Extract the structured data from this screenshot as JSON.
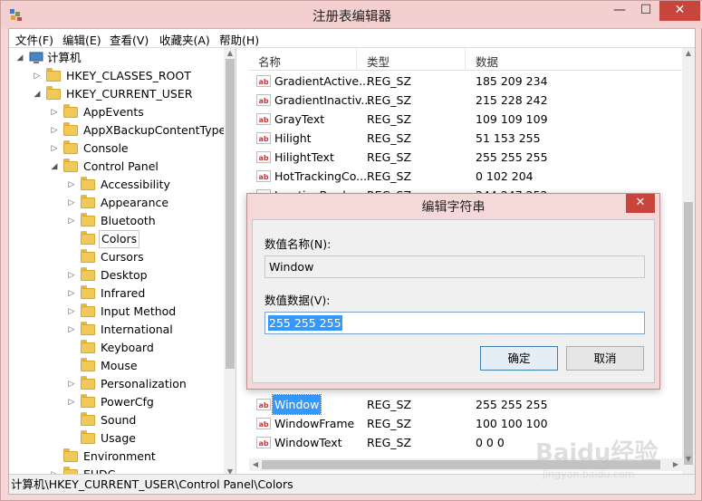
{
  "window": {
    "title": "注册表编辑器",
    "min": "—",
    "max": "☐",
    "close": "✕"
  },
  "menu": [
    "文件(F)",
    "编辑(E)",
    "查看(V)",
    "收藏夹(A)",
    "帮助(H)"
  ],
  "tree": {
    "root": "计算机",
    "hkcr": "HKEY_CLASSES_ROOT",
    "hkcu": "HKEY_CURRENT_USER",
    "hkcu_children": [
      "AppEvents",
      "AppXBackupContentType",
      "Console",
      "Control Panel"
    ],
    "control_panel_children": [
      "Accessibility",
      "Appearance",
      "Bluetooth",
      "Colors",
      "Cursors",
      "Desktop",
      "Infrared",
      "Input Method",
      "International",
      "Keyboard",
      "Mouse",
      "Personalization",
      "PowerCfg",
      "Sound",
      "Usage"
    ],
    "after": [
      "Environment",
      "EUDC"
    ],
    "selected": "Colors"
  },
  "list": {
    "columns": [
      "名称",
      "类型",
      "数据"
    ],
    "rows_top": [
      {
        "name": "GradientActive...",
        "type": "REG_SZ",
        "data": "185 209 234"
      },
      {
        "name": "GradientInactiv...",
        "type": "REG_SZ",
        "data": "215 228 242"
      },
      {
        "name": "GrayText",
        "type": "REG_SZ",
        "data": "109 109 109"
      },
      {
        "name": "Hilight",
        "type": "REG_SZ",
        "data": "51 153 255"
      },
      {
        "name": "HilightText",
        "type": "REG_SZ",
        "data": "255 255 255"
      },
      {
        "name": "HotTrackingCo...",
        "type": "REG_SZ",
        "data": "0 102 204"
      },
      {
        "name": "InactiveBorder",
        "type": "REG_SZ",
        "data": "244 247 252"
      }
    ],
    "rows_bottom": [
      {
        "name": "Window",
        "type": "REG_SZ",
        "data": "255 255 255",
        "selected": true
      },
      {
        "name": "WindowFrame",
        "type": "REG_SZ",
        "data": "100 100 100"
      },
      {
        "name": "WindowText",
        "type": "REG_SZ",
        "data": "0 0 0"
      }
    ],
    "icon_text": "ab"
  },
  "status": "计算机\\HKEY_CURRENT_USER\\Control Panel\\Colors",
  "dialog": {
    "title": "编辑字符串",
    "close": "✕",
    "name_label": "数值名称(N):",
    "name_value": "Window",
    "data_label": "数值数据(V):",
    "data_value": "255 255 255",
    "ok": "确定",
    "cancel": "取消"
  },
  "watermark": {
    "text": "Baidu经验",
    "url": "jingyan.baidu.com"
  },
  "colors": {
    "accent": "#3399ff",
    "titlebar": "#f3cfcf",
    "close": "#c7453c"
  }
}
